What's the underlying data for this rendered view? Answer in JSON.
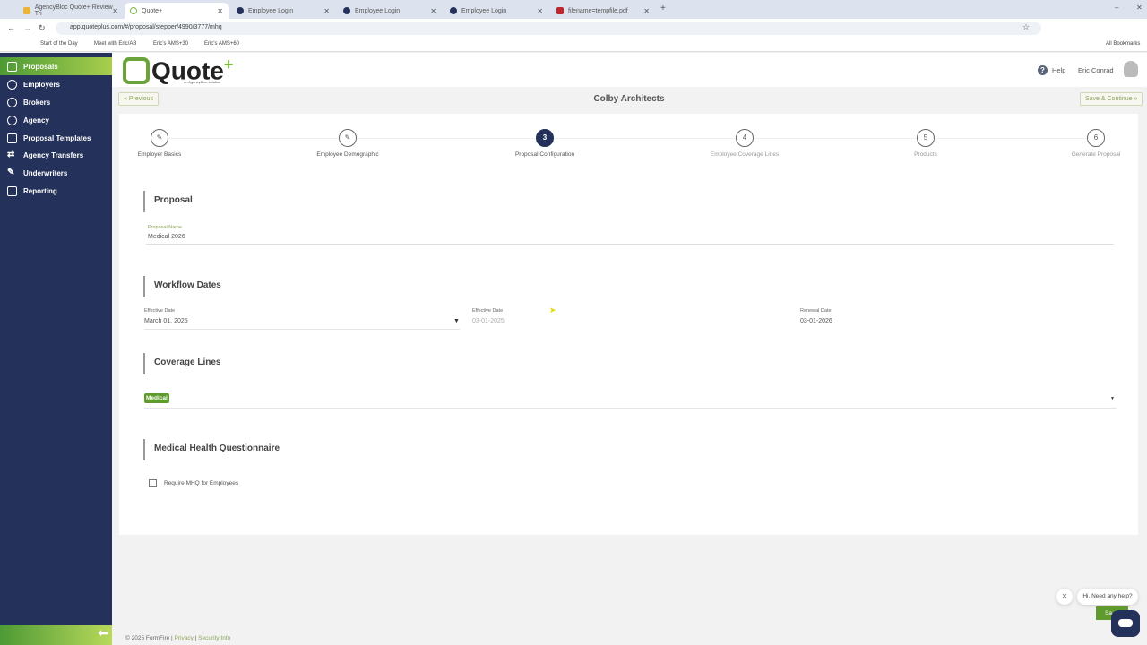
{
  "browser": {
    "tabs": [
      {
        "label": "AgencyBloc Quote+ Review Tri"
      },
      {
        "label": "Quote+"
      },
      {
        "label": "Employee Login"
      },
      {
        "label": "Employee Login"
      },
      {
        "label": "Employee Login"
      },
      {
        "label": "filename=tempfile.pdf"
      }
    ],
    "url": "app.quoteplus.com/#/proposal/stepper/4990/3777/mhq",
    "bookmarks": [
      "Start of the Day",
      "Meet with Eric/AB",
      "Eric's AMS+30",
      "Eric's AMS+60"
    ],
    "all_bookmarks": "All Bookmarks"
  },
  "sidebar": {
    "items": [
      {
        "label": "Proposals",
        "active": true
      },
      {
        "label": "Employers"
      },
      {
        "label": "Brokers"
      },
      {
        "label": "Agency"
      },
      {
        "label": "Proposal Templates"
      },
      {
        "label": "Agency Transfers"
      },
      {
        "label": "Underwriters"
      },
      {
        "label": "Reporting"
      }
    ]
  },
  "header": {
    "logo": "Quote+",
    "logo_sub": "an AgencyBloc solution",
    "help": "Help",
    "user": "Eric Conrad"
  },
  "toolbar": {
    "previous": "« Previous",
    "client": "Colby Architects",
    "save_continue": "Save & Continue »"
  },
  "stepper": [
    {
      "num": "✎",
      "label": "Employer Basics",
      "state": "done"
    },
    {
      "num": "✎",
      "label": "Employee Demographic",
      "state": "done"
    },
    {
      "num": "3",
      "label": "Proposal Configuration",
      "state": "current"
    },
    {
      "num": "4",
      "label": "Employee Coverage Lines",
      "state": "future"
    },
    {
      "num": "5",
      "label": "Products",
      "state": "future"
    },
    {
      "num": "6",
      "label": "Generate Proposal",
      "state": "future"
    }
  ],
  "proposal": {
    "title": "Proposal",
    "name_label": "Proposal Name",
    "name_value": "Medical 2026"
  },
  "workflow": {
    "title": "Workflow Dates",
    "eff_label": "Effective Date",
    "eff_value": "March 01, 2025",
    "eff2_label": "Effective Date",
    "eff2_value": "03-01-2025",
    "renewal_label": "Renewal Date",
    "renewal_value": "03-01-2026"
  },
  "coverage": {
    "title": "Coverage Lines",
    "chip": "Medical"
  },
  "mhq": {
    "title": "Medical Health Questionnaire",
    "checkbox_label": "Require MHQ for Employees",
    "checked": false
  },
  "footer": {
    "copyright": "© 2025 FormFire |",
    "privacy": "Privacy",
    "sep": "|",
    "security": "Security Info"
  },
  "chat": {
    "message": "Hi. Need any help?",
    "save_partial": "Sa"
  },
  "colors": {
    "navy": "#24315a",
    "green": "#5e9a2c"
  }
}
